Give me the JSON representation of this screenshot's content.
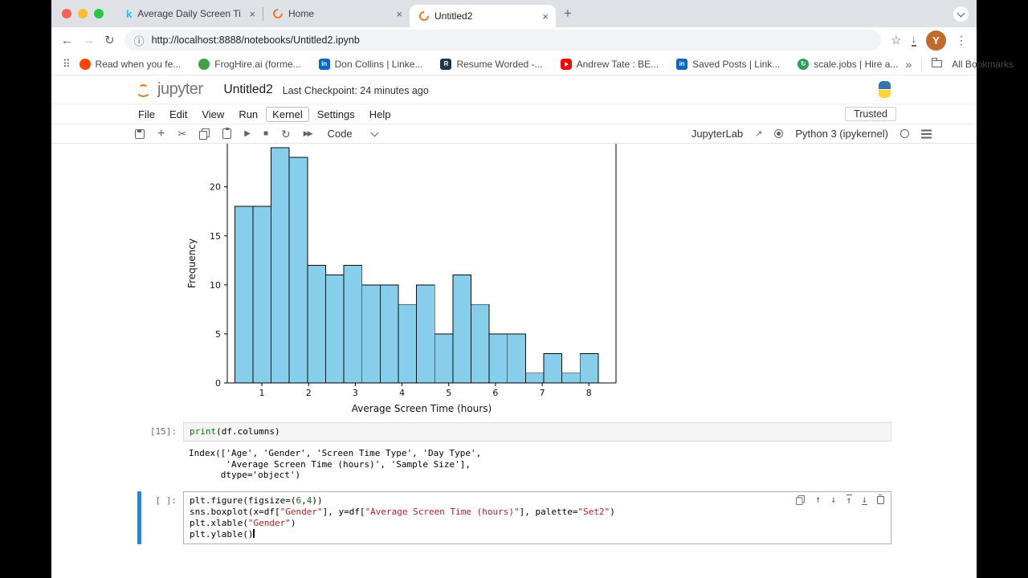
{
  "icons": {
    "kaggle_glyph": "k"
  },
  "browser": {
    "tab_bar": {
      "tabs": [
        {
          "title": "Average Daily Screen Time fo",
          "favicon": "kaggle",
          "active": false
        },
        {
          "title": "Home",
          "favicon": "jupyter",
          "active": false
        },
        {
          "title": "Untitled2",
          "favicon": "jupyter",
          "active": true
        }
      ]
    },
    "address_bar": {
      "url": "http://localhost:8888/notebooks/Untitled2.ipynb",
      "avatar_letter": "Y"
    },
    "bookmarks_bar": {
      "items": [
        {
          "label": "Read when you fe...",
          "icon": "red-site",
          "color": "#ff4500",
          "shape": "circle",
          "glyph": ""
        },
        {
          "label": "FrogHire.ai (forme...",
          "icon": "froghire",
          "color": "#43a047",
          "shape": "circle",
          "glyph": ""
        },
        {
          "label": "Don Collins | Linke...",
          "icon": "linkedin",
          "color": "#0a66c2",
          "shape": "square",
          "glyph": "in"
        },
        {
          "label": "Resume Worded -...",
          "icon": "resume-worded",
          "color": "#22354f",
          "shape": "square",
          "glyph": "R"
        },
        {
          "label": "Andrew Tate : BE...",
          "icon": "youtube",
          "color": "#ff0000",
          "shape": "play",
          "glyph": ""
        },
        {
          "label": "Saved Posts | Link...",
          "icon": "linkedin",
          "color": "#0a66c2",
          "shape": "square",
          "glyph": "in"
        },
        {
          "label": "scale.jobs | Hire a...",
          "icon": "scalejobs",
          "color": "#2e9e5b",
          "shape": "circle",
          "glyph": "↻"
        }
      ],
      "overflow_glyph": "»",
      "all_bookmarks": "All Bookmarks"
    }
  },
  "notebook": {
    "header": {
      "logo_text": "jupyter",
      "title": "Untitled2",
      "checkpoint": "Last Checkpoint: 24 minutes ago"
    },
    "menu": {
      "items": [
        "File",
        "Edit",
        "View",
        "Run",
        "Kernel",
        "Settings",
        "Help"
      ],
      "highlighted": "Kernel",
      "trusted_label": "Trusted"
    },
    "toolbar": {
      "cell_type": "Code",
      "jupyterlab_label": "JupyterLab",
      "kernel_label": "Python 3 (ipykernel)"
    }
  },
  "chart_data": {
    "type": "bar",
    "subtype": "histogram",
    "title": "",
    "xlabel": "Average Screen Time (hours)",
    "ylabel": "Frequency",
    "bin_start": 0.42,
    "bin_width": 0.389,
    "counts": [
      18,
      18,
      24,
      23,
      12,
      11,
      12,
      10,
      10,
      8,
      10,
      5,
      11,
      8,
      5,
      5,
      1,
      3,
      1,
      3
    ],
    "x_ticks": [
      1,
      2,
      3,
      4,
      5,
      6,
      7,
      8
    ],
    "y_ticks": [
      0,
      5,
      10,
      15,
      20
    ],
    "xlim": [
      0.26,
      8.58
    ],
    "ylim": [
      0,
      24.4
    ],
    "top_cropped": true,
    "grid": false,
    "legend": "none",
    "bar_fill": "#87ceeb",
    "bar_edge": "#0a0a0a"
  },
  "cells": {
    "print_cell": {
      "prompt": "[15]:",
      "code": [
        [
          {
            "t": "print",
            "c": "b"
          },
          {
            "t": "(df.columns)",
            "c": "p"
          }
        ]
      ],
      "output": [
        "Index(['Age', 'Gender', 'Screen Time Type', 'Day Type',",
        "       'Average Screen Time (hours)', 'Sample Size'],",
        "      dtype='object')"
      ]
    },
    "active_cell": {
      "prompt": "[ ]:",
      "code": [
        [
          {
            "t": "plt.figure(figsize=(",
            "c": "p"
          },
          {
            "t": "6",
            "c": "n"
          },
          {
            "t": ",",
            "c": "p"
          },
          {
            "t": "4",
            "c": "n"
          },
          {
            "t": "))",
            "c": "p"
          }
        ],
        [
          {
            "t": "sns.boxplot(x=df[",
            "c": "p"
          },
          {
            "t": "\"Gender\"",
            "c": "s"
          },
          {
            "t": "], y=df[",
            "c": "p"
          },
          {
            "t": "\"Average Screen Time (hours)\"",
            "c": "s"
          },
          {
            "t": "], palette=",
            "c": "p"
          },
          {
            "t": "\"Set2\"",
            "c": "s"
          },
          {
            "t": ")",
            "c": "p"
          }
        ],
        [
          {
            "t": "plt.xlable(",
            "c": "p"
          },
          {
            "t": "\"Gender\"",
            "c": "s"
          },
          {
            "t": ")",
            "c": "p"
          }
        ],
        [
          {
            "t": "plt.ylable()",
            "c": "p"
          },
          {
            "t": "",
            "c": "cursor"
          }
        ]
      ]
    }
  }
}
